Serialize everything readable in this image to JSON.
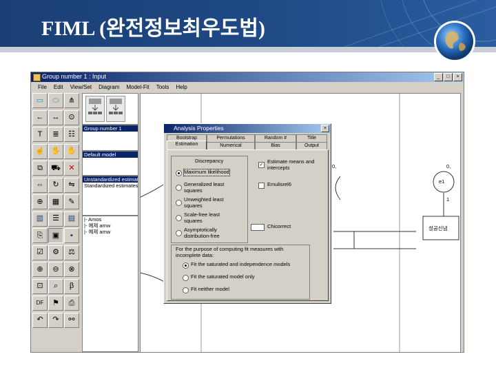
{
  "slide": {
    "title": "FIML (완전정보최우도법)",
    "colors": {
      "header": "#1f4a86",
      "underline": "#c8cdd6"
    }
  },
  "window": {
    "title": "Group number 1 : Input",
    "menu": [
      "File",
      "Edit",
      "View/Set",
      "Diagram",
      "Model-Fit",
      "Tools",
      "Help"
    ],
    "minimize": "_",
    "maximize": "□",
    "close": "×"
  },
  "toolbox": {
    "tools": [
      "rectangle-icon",
      "ellipse-icon",
      "latent-indicator-icon",
      "single-arrow-icon",
      "double-arrow-icon",
      "error-term-icon",
      "title-icon",
      "list-variables-icon",
      "list-data-icon",
      "select-one-icon",
      "select-all-icon",
      "deselect-all-icon",
      "duplicate-icon",
      "move-icon",
      "erase-icon",
      "resize-icon",
      "rotate-icon",
      "reflect-icon",
      "move-params-icon",
      "reposition-icon",
      "touch-up-icon",
      "data-file-icon",
      "analysis-properties-icon",
      "calculate-icon",
      "copy-icon",
      "view-text-icon",
      "save-icon",
      "object-properties-icon",
      "drag-properties-icon",
      "preserve-symmetry-icon",
      "zoom-in-icon",
      "zoom-out-icon",
      "zoom-page-icon",
      "fit-page-icon",
      "loupe-icon",
      "bayesian-icon",
      "df-icon",
      "multiple-group-icon",
      "print-icon",
      "undo-icon",
      "redo-icon",
      "specification-search-icon"
    ],
    "df_label": "DF",
    "undo_glyph": "↶",
    "redo_glyph": "↷"
  },
  "sidepanel": {
    "group_list": [
      "Group number 1"
    ],
    "model_list": [
      "Default model"
    ],
    "output_list": [
      "Unstandardized estimates",
      "Standardized estimates"
    ],
    "files": [
      "|- Amos",
      "|- 예제 amw",
      "|- 예제 amw"
    ]
  },
  "dialog": {
    "title": "Analysis Properties",
    "close": "×",
    "tabs_row1": [
      "Bootstrap",
      "Permutations",
      "Random #",
      "Title"
    ],
    "tabs_row2": [
      "Estimation",
      "Numerical",
      "Bias",
      "Output"
    ],
    "discrepancy": {
      "heading": "Discrepancy",
      "options": [
        "Maximum likelihood",
        "Generalized least squares",
        "Unweighted least squares",
        "Scale-free least squares",
        "Asymptotically distribution-free"
      ],
      "selected": 0
    },
    "estimate_means": {
      "label": "Estimate means and intercepts",
      "checked": true
    },
    "emulisrel": {
      "label": "Emulisrel6",
      "checked": false
    },
    "chicorrect": "Chicorrect",
    "incomplete": {
      "heading": "For the purpose of computing fit measures with incomplete data:",
      "options": [
        "Fit the saturated and independence models",
        "Fit the saturated model only",
        "Fit neither model"
      ],
      "selected": 0
    }
  },
  "diagram": {
    "node_label": "e1",
    "node_value": "0,",
    "path_value": "1",
    "box_label": "성공신념",
    "left_marker": "0,"
  }
}
